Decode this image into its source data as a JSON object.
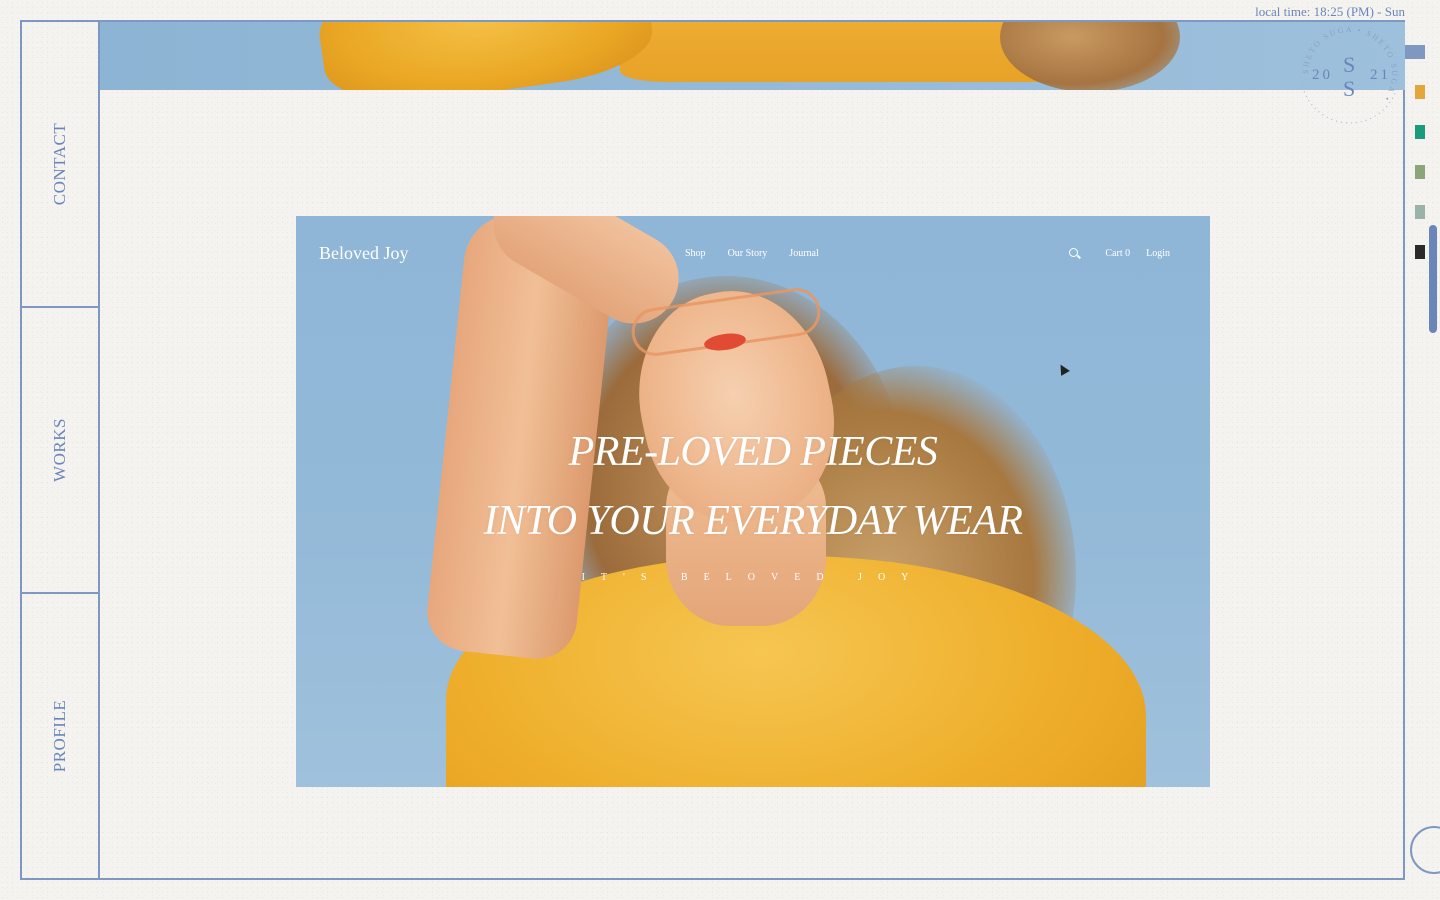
{
  "local_time": "local time: 18:25 (PM) - Sun",
  "sidebar": {
    "items": [
      {
        "label": "CONTACT"
      },
      {
        "label": "WORKS"
      },
      {
        "label": "PROFILE"
      }
    ]
  },
  "stamp": {
    "year_left": "20",
    "year_right": "21",
    "initials_top": "S",
    "initials_bottom": "S",
    "ring_text": "SHETO SUGA • SHETO SUGA •"
  },
  "hero": {
    "brand": "Beloved Joy",
    "nav": [
      {
        "label": "Shop"
      },
      {
        "label": "Our Story"
      },
      {
        "label": "Journal"
      }
    ],
    "cart_label": "Cart 0",
    "login_label": "Login",
    "title_line1": "PRE-LOVED PIECES",
    "title_line2": "INTO YOUR EVERYDAY WEAR",
    "subtitle": "IT'S BELOVED JOY"
  },
  "swatches": {
    "colors": [
      "#7f98c2",
      "#e2a63a",
      "#1a9b7a",
      "#8aa57a",
      "#9ab3a8",
      "#2a2a2a"
    ]
  },
  "colors": {
    "accent": "#6a86b8",
    "frame": "#7f98c2",
    "hero_sky": "#93b9d8",
    "shirt": "#eeae2a"
  }
}
